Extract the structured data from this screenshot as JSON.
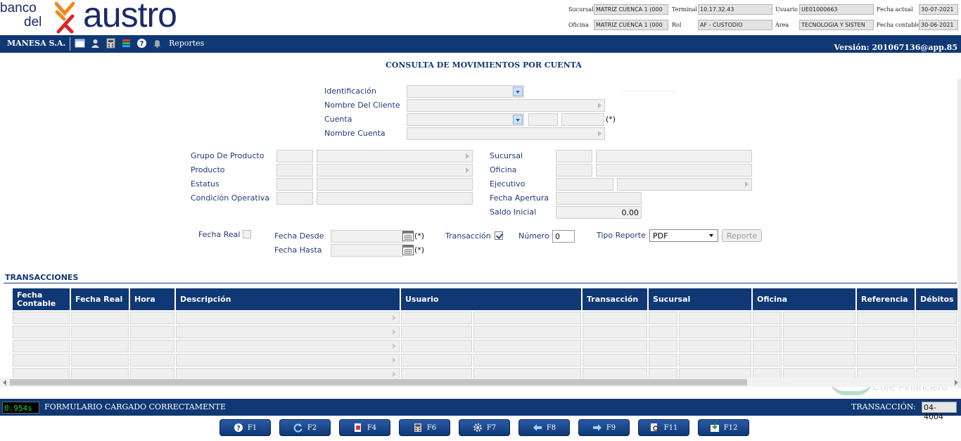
{
  "header": {
    "logo": {
      "line1": "banco",
      "line2": "del",
      "brand": "austro"
    },
    "fields": {
      "sucursal": {
        "label": "Sucursal",
        "value": "MATRIZ CUENCA 1 (000"
      },
      "oficina": {
        "label": "Oficina",
        "value": "MATRIZ CUENCA 1 (000"
      },
      "terminal": {
        "label": "Terminal",
        "value": "10.17.32.43"
      },
      "rol": {
        "label": "Rol",
        "value": "AF - CUSTODIO"
      },
      "usuario": {
        "label": "Usuario",
        "value": "UE01000663"
      },
      "area": {
        "label": "Área",
        "value": "TECNOLOGIA Y SISTEN"
      },
      "fecha_actual": {
        "label": "Fecha actual",
        "value": "30-07-2021"
      },
      "fecha_contable": {
        "label": "Fecha contable",
        "value": "30-06-2021"
      }
    }
  },
  "navbar": {
    "company": "MANESA S.A.",
    "icons": [
      "window-icon",
      "users-icon",
      "calculator-icon",
      "books-icon",
      "help-icon",
      "bell-icon"
    ],
    "reports": "Reportes",
    "version": "Versión: 201067136@app.85"
  },
  "form": {
    "title": "CONSULTA DE MOVIMIENTOS POR CUENTA",
    "identificacion": "Identificación",
    "nombre_cliente": "Nombre Del Cliente",
    "cuenta": "Cuenta",
    "cuenta_required": "(*)",
    "nombre_cuenta": "Nombre Cuenta",
    "grupo_producto": "Grupo De Producto",
    "producto": "Producto",
    "estatus": "Estatus",
    "condicion_operativa": "Condición Operativa",
    "sucursal": "Sucursal",
    "oficina": "Oficina",
    "ejecutivo": "Ejecutivo",
    "fecha_apertura": "Fecha Apertura",
    "saldo_inicial": "Saldo Inicial",
    "saldo_inicial_value": "0.00",
    "fecha_real": "Fecha Real",
    "fecha_real_checked": false,
    "fecha_desde": "Fecha Desde",
    "fecha_hasta": "Fecha Hasta",
    "required": "(*)",
    "transaccion": "Transacción",
    "transaccion_checked": true,
    "numero": "Número",
    "numero_value": "0",
    "tipo_reporte": "Tipo Reporte",
    "tipo_reporte_value": "PDF",
    "reporte_button": "Reporte"
  },
  "transactions": {
    "title": "TRANSACCIONES",
    "columns": [
      "Fecha Contable",
      "Fecha Real",
      "Hora",
      "Descripción",
      "Usuario",
      "Transacción",
      "Sucursal",
      "Oficina",
      "Referencia",
      "Débitos"
    ],
    "row_count": 5
  },
  "watermark": {
    "text": "Core Financiero"
  },
  "statusbar": {
    "timer": "0.954s",
    "message": "FORMULARIO CARGADO CORRECTAMENTE",
    "transaction_label": "TRANSACCIÓN:",
    "transaction_code": "04-4004"
  },
  "function_keys": [
    {
      "label": "F1",
      "icon": "help-icon"
    },
    {
      "label": "F2",
      "icon": "refresh-icon"
    },
    {
      "label": "F4",
      "icon": "document-icon"
    },
    {
      "label": "F6",
      "icon": "calculator-icon"
    },
    {
      "label": "F7",
      "icon": "gear-icon"
    },
    {
      "label": "F8",
      "icon": "arrow-left-icon"
    },
    {
      "label": "F9",
      "icon": "arrow-right-icon"
    },
    {
      "label": "F11",
      "icon": "search-document-icon"
    },
    {
      "label": "F12",
      "icon": "save-icon"
    }
  ],
  "colors": {
    "brand_navy": "#0f3874",
    "brand_orange": "#f08a1c",
    "brand_red": "#d9262c",
    "timer_green": "#1fd32a"
  }
}
